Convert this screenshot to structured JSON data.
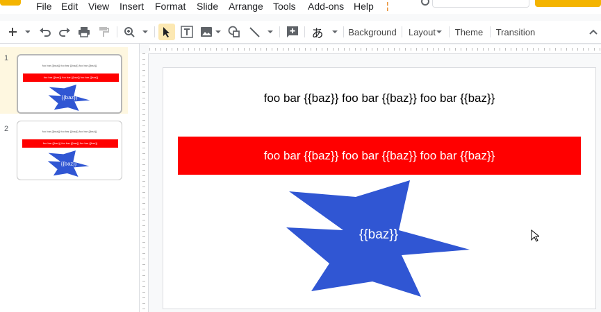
{
  "menu": {
    "items": [
      "File",
      "Edit",
      "View",
      "Insert",
      "Format",
      "Slide",
      "Arrange",
      "Tools",
      "Add-ons",
      "Help"
    ],
    "last_edit": "¦"
  },
  "toolbar": {
    "background": "Background",
    "layout": "Layout",
    "theme": "Theme",
    "transition": "Transition",
    "input_tools_glyph": "あ"
  },
  "filmstrip": {
    "slides": [
      {
        "number": "1",
        "title": "foo bar {{baz}} foo bar {{baz}} foo bar {{baz}}",
        "bar": "foo bar {{baz}} foo bar {{baz}} foo bar {{baz}}",
        "star": "{{baz}}"
      },
      {
        "number": "2",
        "title": "foo bar {{baz}} foo bar {{baz}} foo bar {{baz}}",
        "bar": "foo bar {{baz}} foo bar {{baz}} foo bar {{baz}}",
        "star": "{{baz}}"
      }
    ]
  },
  "slide": {
    "title_text": "foo bar {{baz}} foo bar {{baz}} foo bar {{baz}}",
    "red_box_text": "foo bar {{baz}} foo bar {{baz}} foo bar {{baz}}",
    "star_text": "{{baz}}"
  },
  "colors": {
    "accent": "#f4b400",
    "red_box": "#ff0000",
    "star": "#3056d3",
    "selected_slide_bg": "#fef7e0"
  }
}
